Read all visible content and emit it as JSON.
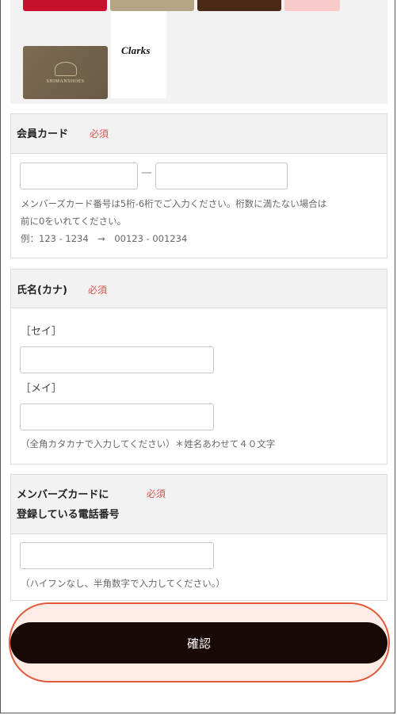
{
  "brands": {
    "card_name": "SHIMANSHOES",
    "clarks_logo": "Clarks"
  },
  "member_card": {
    "title": "会員カード",
    "required": "必須",
    "separator": "—",
    "note_line1": "メンバーズカード番号は5桁-6桁でご入力ください。桁数に満たない場合は",
    "note_line2": "前に0をいれてください。",
    "note_line3": "例：123 - 1234　→　00123 - 001234"
  },
  "name_kana": {
    "title": "氏名(カナ)",
    "required": "必須",
    "sei_label": "［セイ］",
    "mei_label": "［メイ］",
    "note": "（全角カタカナで入力してください）＊姓名あわせて４０文字"
  },
  "phone": {
    "title_line1": "メンバーズカードに",
    "title_line2": "登録している電話番号",
    "required": "必須",
    "note": "（ハイフンなし、半角数字で入力してください。）"
  },
  "confirm": {
    "label": "確認"
  },
  "colors": {
    "required": "#d9534f",
    "button": "#180806",
    "highlight": "#e05a3a"
  }
}
